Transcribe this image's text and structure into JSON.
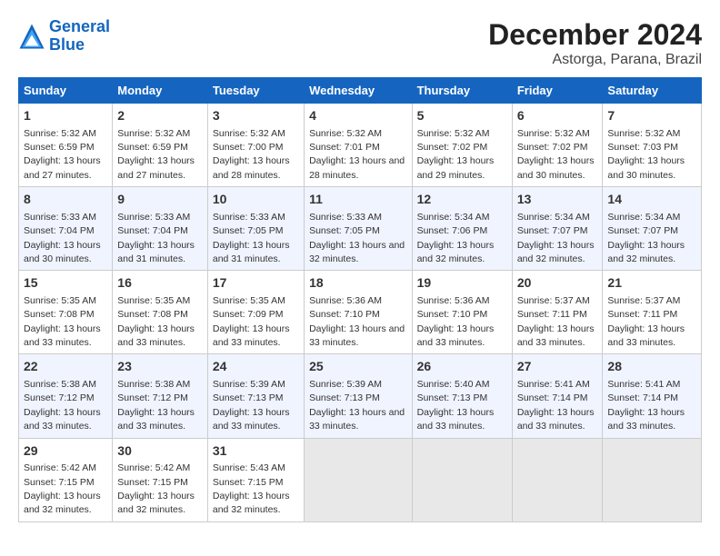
{
  "logo": {
    "line1": "General",
    "line2": "Blue"
  },
  "title": "December 2024",
  "subtitle": "Astorga, Parana, Brazil",
  "headers": [
    "Sunday",
    "Monday",
    "Tuesday",
    "Wednesday",
    "Thursday",
    "Friday",
    "Saturday"
  ],
  "weeks": [
    [
      {
        "day": "1",
        "sunrise": "5:32 AM",
        "sunset": "6:59 PM",
        "daylight": "13 hours and 27 minutes."
      },
      {
        "day": "2",
        "sunrise": "5:32 AM",
        "sunset": "6:59 PM",
        "daylight": "13 hours and 27 minutes."
      },
      {
        "day": "3",
        "sunrise": "5:32 AM",
        "sunset": "7:00 PM",
        "daylight": "13 hours and 28 minutes."
      },
      {
        "day": "4",
        "sunrise": "5:32 AM",
        "sunset": "7:01 PM",
        "daylight": "13 hours and 28 minutes."
      },
      {
        "day": "5",
        "sunrise": "5:32 AM",
        "sunset": "7:02 PM",
        "daylight": "13 hours and 29 minutes."
      },
      {
        "day": "6",
        "sunrise": "5:32 AM",
        "sunset": "7:02 PM",
        "daylight": "13 hours and 30 minutes."
      },
      {
        "day": "7",
        "sunrise": "5:32 AM",
        "sunset": "7:03 PM",
        "daylight": "13 hours and 30 minutes."
      }
    ],
    [
      {
        "day": "8",
        "sunrise": "5:33 AM",
        "sunset": "7:04 PM",
        "daylight": "13 hours and 30 minutes."
      },
      {
        "day": "9",
        "sunrise": "5:33 AM",
        "sunset": "7:04 PM",
        "daylight": "13 hours and 31 minutes."
      },
      {
        "day": "10",
        "sunrise": "5:33 AM",
        "sunset": "7:05 PM",
        "daylight": "13 hours and 31 minutes."
      },
      {
        "day": "11",
        "sunrise": "5:33 AM",
        "sunset": "7:05 PM",
        "daylight": "13 hours and 32 minutes."
      },
      {
        "day": "12",
        "sunrise": "5:34 AM",
        "sunset": "7:06 PM",
        "daylight": "13 hours and 32 minutes."
      },
      {
        "day": "13",
        "sunrise": "5:34 AM",
        "sunset": "7:07 PM",
        "daylight": "13 hours and 32 minutes."
      },
      {
        "day": "14",
        "sunrise": "5:34 AM",
        "sunset": "7:07 PM",
        "daylight": "13 hours and 32 minutes."
      }
    ],
    [
      {
        "day": "15",
        "sunrise": "5:35 AM",
        "sunset": "7:08 PM",
        "daylight": "13 hours and 33 minutes."
      },
      {
        "day": "16",
        "sunrise": "5:35 AM",
        "sunset": "7:08 PM",
        "daylight": "13 hours and 33 minutes."
      },
      {
        "day": "17",
        "sunrise": "5:35 AM",
        "sunset": "7:09 PM",
        "daylight": "13 hours and 33 minutes."
      },
      {
        "day": "18",
        "sunrise": "5:36 AM",
        "sunset": "7:10 PM",
        "daylight": "13 hours and 33 minutes."
      },
      {
        "day": "19",
        "sunrise": "5:36 AM",
        "sunset": "7:10 PM",
        "daylight": "13 hours and 33 minutes."
      },
      {
        "day": "20",
        "sunrise": "5:37 AM",
        "sunset": "7:11 PM",
        "daylight": "13 hours and 33 minutes."
      },
      {
        "day": "21",
        "sunrise": "5:37 AM",
        "sunset": "7:11 PM",
        "daylight": "13 hours and 33 minutes."
      }
    ],
    [
      {
        "day": "22",
        "sunrise": "5:38 AM",
        "sunset": "7:12 PM",
        "daylight": "13 hours and 33 minutes."
      },
      {
        "day": "23",
        "sunrise": "5:38 AM",
        "sunset": "7:12 PM",
        "daylight": "13 hours and 33 minutes."
      },
      {
        "day": "24",
        "sunrise": "5:39 AM",
        "sunset": "7:13 PM",
        "daylight": "13 hours and 33 minutes."
      },
      {
        "day": "25",
        "sunrise": "5:39 AM",
        "sunset": "7:13 PM",
        "daylight": "13 hours and 33 minutes."
      },
      {
        "day": "26",
        "sunrise": "5:40 AM",
        "sunset": "7:13 PM",
        "daylight": "13 hours and 33 minutes."
      },
      {
        "day": "27",
        "sunrise": "5:41 AM",
        "sunset": "7:14 PM",
        "daylight": "13 hours and 33 minutes."
      },
      {
        "day": "28",
        "sunrise": "5:41 AM",
        "sunset": "7:14 PM",
        "daylight": "13 hours and 33 minutes."
      }
    ],
    [
      {
        "day": "29",
        "sunrise": "5:42 AM",
        "sunset": "7:15 PM",
        "daylight": "13 hours and 32 minutes."
      },
      {
        "day": "30",
        "sunrise": "5:42 AM",
        "sunset": "7:15 PM",
        "daylight": "13 hours and 32 minutes."
      },
      {
        "day": "31",
        "sunrise": "5:43 AM",
        "sunset": "7:15 PM",
        "daylight": "13 hours and 32 minutes."
      },
      null,
      null,
      null,
      null
    ]
  ]
}
